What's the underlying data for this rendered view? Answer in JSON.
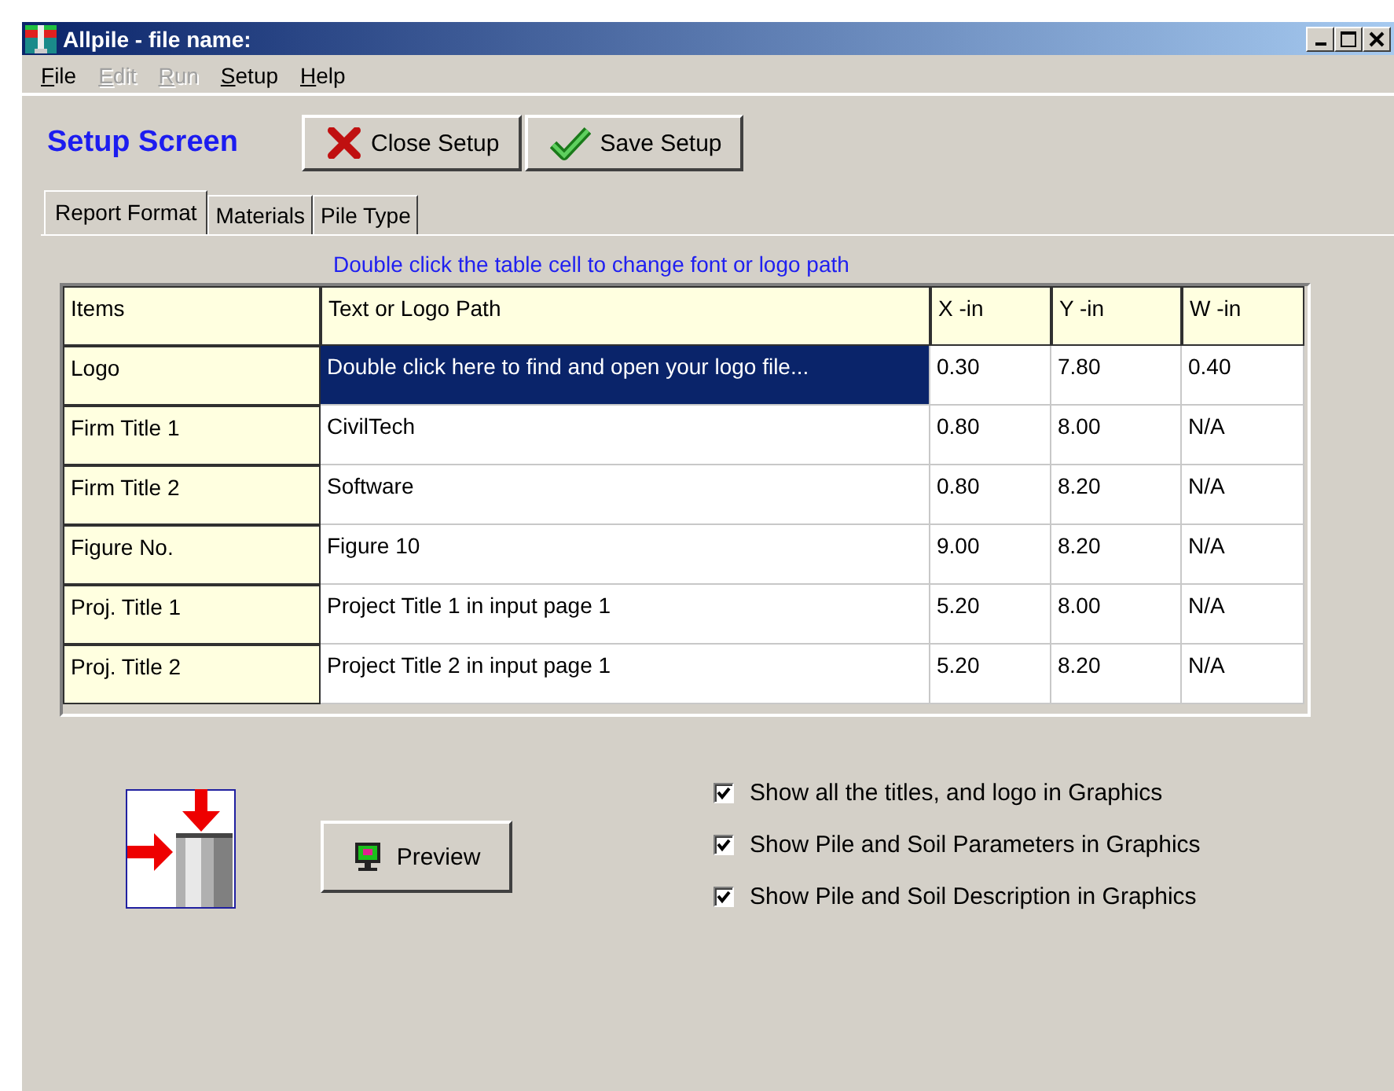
{
  "window": {
    "title": "Allpile - file name:"
  },
  "menu": [
    {
      "label": "File",
      "disabled": false
    },
    {
      "label": "Edit",
      "disabled": true
    },
    {
      "label": "Run",
      "disabled": true
    },
    {
      "label": "Setup",
      "disabled": false
    },
    {
      "label": "Help",
      "disabled": false
    }
  ],
  "toolbar": {
    "heading": "Setup Screen",
    "buttons": [
      {
        "label": "Close Setup",
        "kind": "close"
      },
      {
        "label": "Save Setup",
        "kind": "save"
      }
    ]
  },
  "tabs": [
    {
      "label": "Report Format",
      "selected": true
    },
    {
      "label": "Materials",
      "selected": false
    },
    {
      "label": "Pile Type",
      "selected": false
    }
  ],
  "instruction": "Double click the table cell to change font or logo path",
  "table": {
    "columns": [
      "Items",
      "Text or Logo Path",
      "X -in",
      "Y -in",
      "W -in"
    ],
    "rows": [
      {
        "cells": [
          "Logo",
          "Double click here to find and open your logo file...",
          "0.30",
          "7.80",
          "0.40"
        ],
        "selected": true
      },
      {
        "cells": [
          "Firm Title 1",
          "CivilTech",
          "0.80",
          "8.00",
          "N/A"
        ],
        "selected": false
      },
      {
        "cells": [
          "Firm Title 2",
          "Software",
          "0.80",
          "8.20",
          "N/A"
        ],
        "selected": false
      },
      {
        "cells": [
          "Figure No.",
          "Figure 10",
          "9.00",
          "8.20",
          "N/A"
        ],
        "selected": false
      },
      {
        "cells": [
          "Proj. Title 1",
          "Project Title 1 in input page 1",
          "5.20",
          "8.00",
          "N/A"
        ],
        "selected": false
      },
      {
        "cells": [
          "Proj. Title 2",
          "Project Title 2 in input page 1",
          "5.20",
          "8.20",
          "N/A"
        ],
        "selected": false
      }
    ]
  },
  "preview_button": {
    "label": "Preview"
  },
  "options": [
    {
      "label": "Show all the titles, and logo in Graphics",
      "checked": true
    },
    {
      "label": "Show Pile and Soil Parameters in Graphics",
      "checked": true
    },
    {
      "label": "Show Pile and Soil Description in Graphics",
      "checked": true
    }
  ]
}
